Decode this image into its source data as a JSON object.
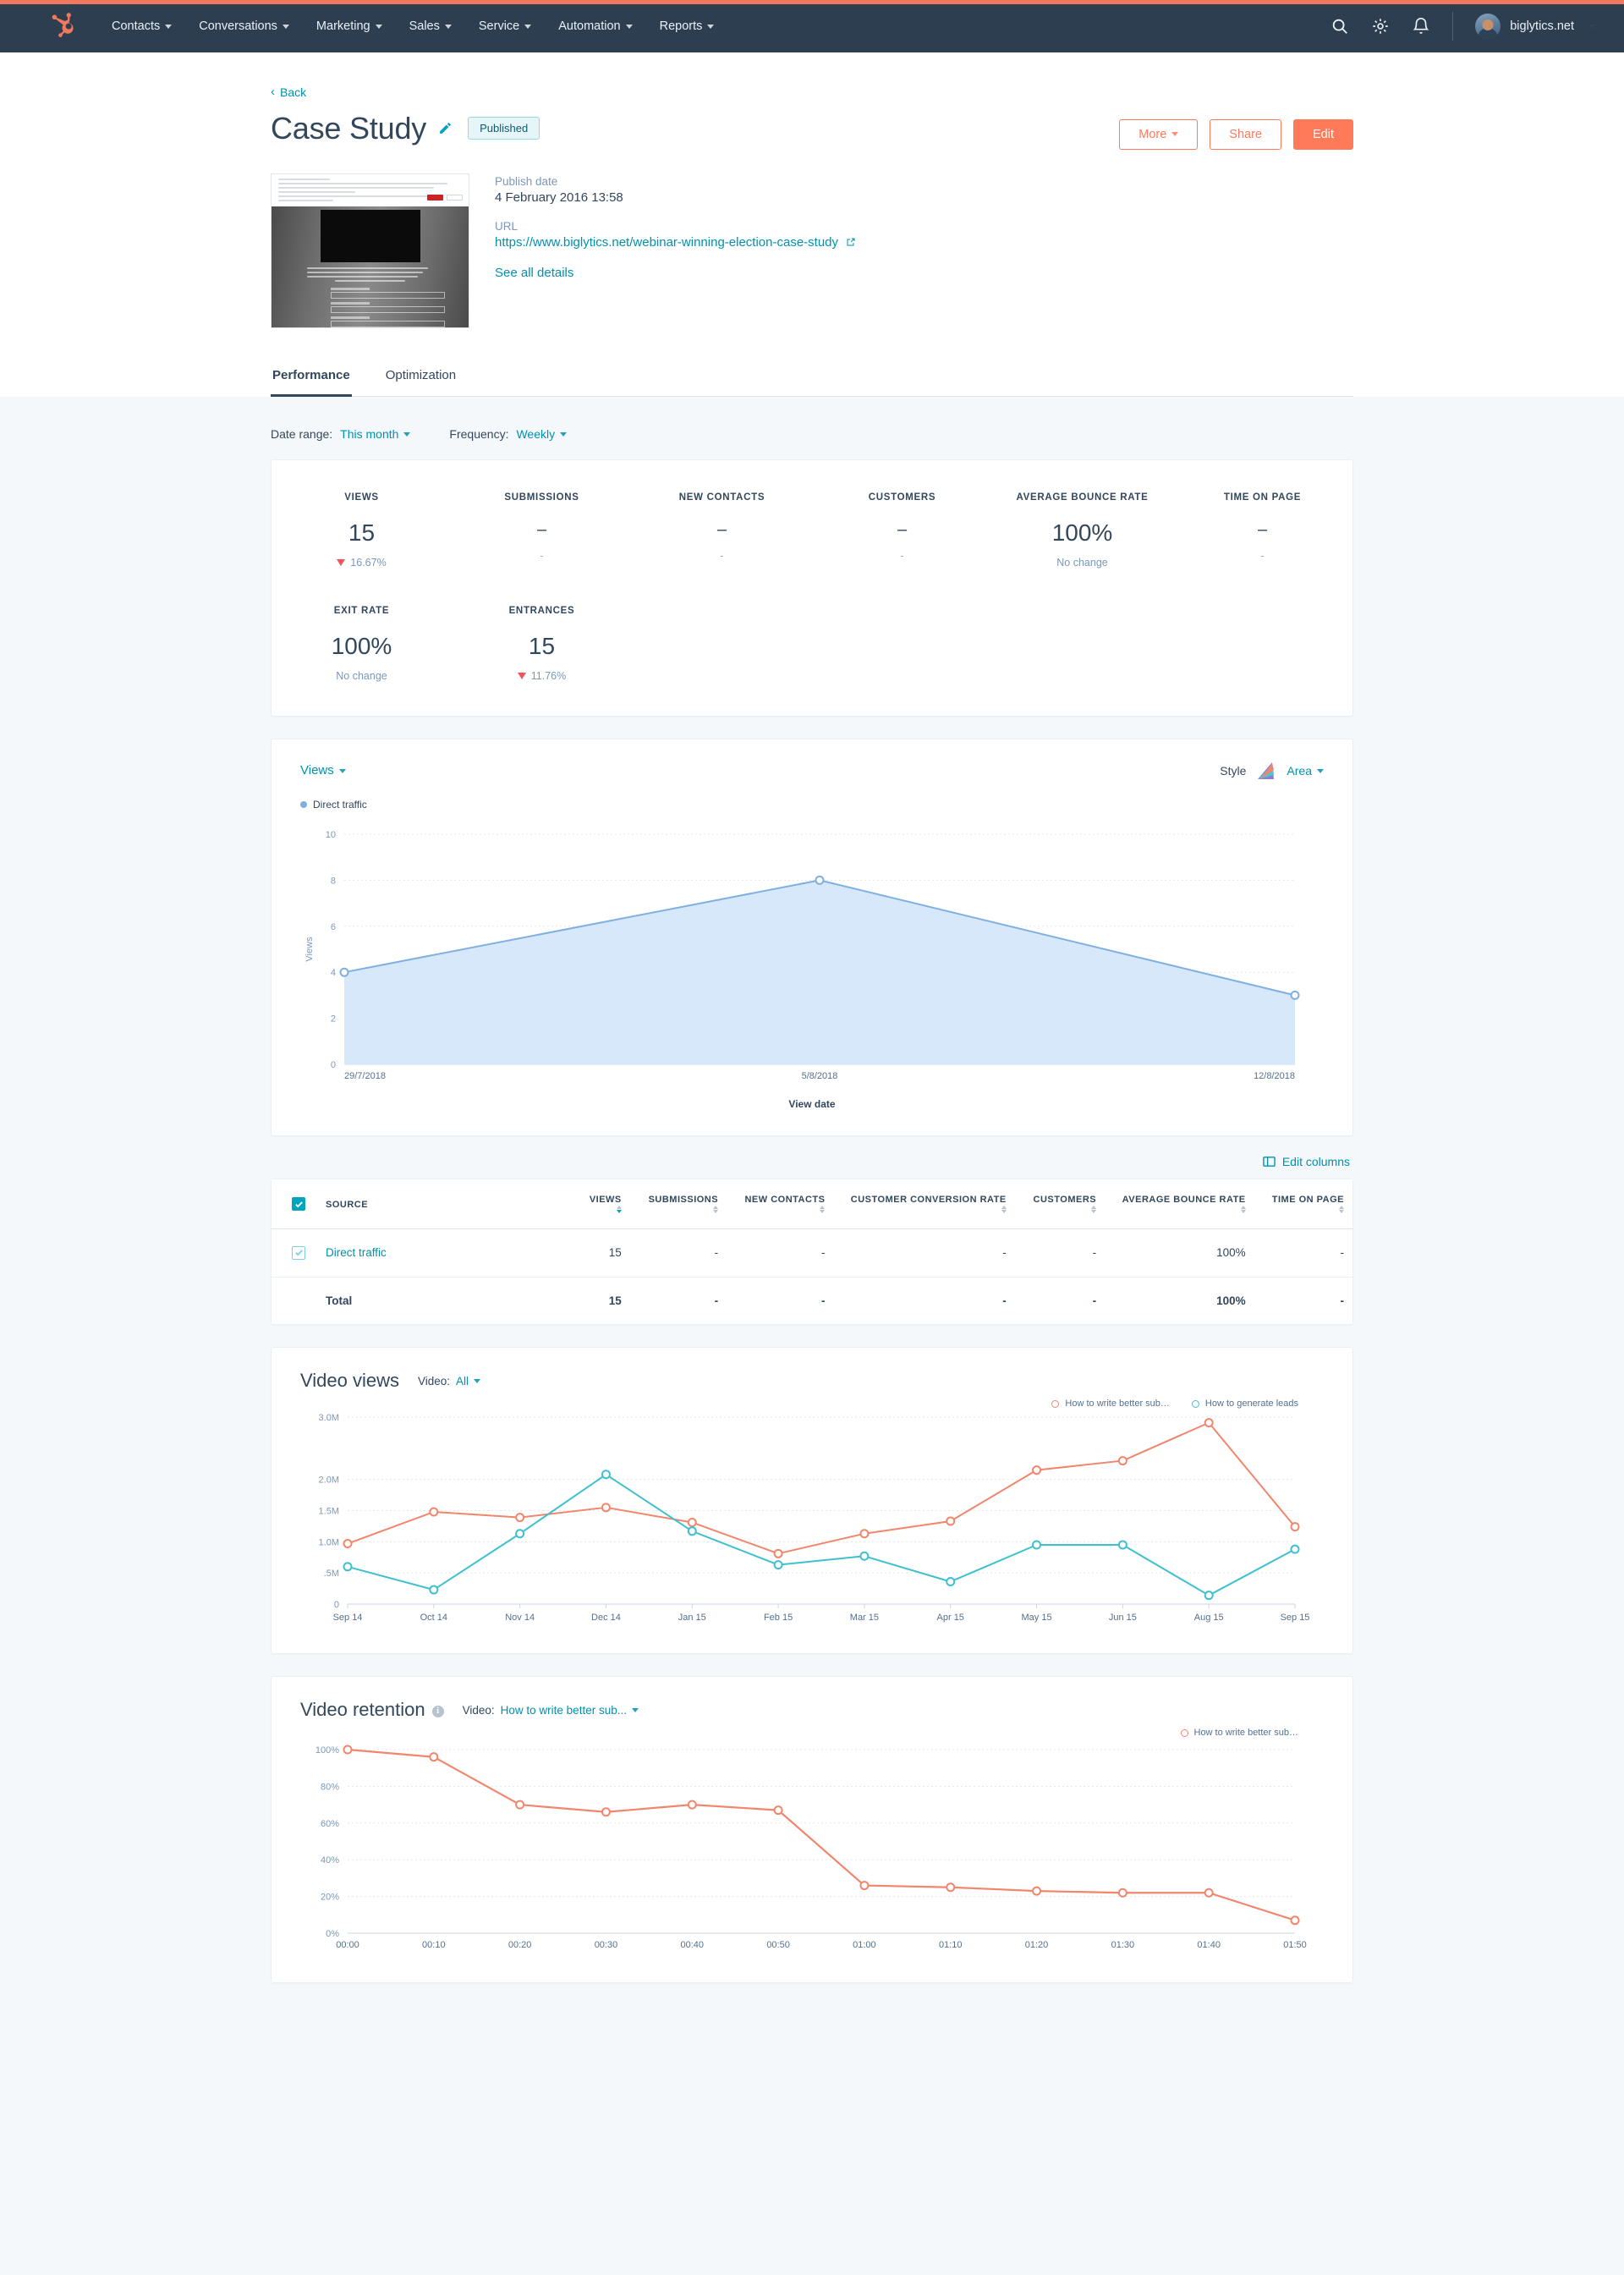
{
  "topnav": {
    "logo": "hubspot-sprocket-logo",
    "items": [
      {
        "label": "Contacts",
        "caret": true
      },
      {
        "label": "Conversations",
        "caret": true
      },
      {
        "label": "Marketing",
        "caret": true
      },
      {
        "label": "Sales",
        "caret": true
      },
      {
        "label": "Service",
        "caret": true
      },
      {
        "label": "Automation",
        "caret": true
      },
      {
        "label": "Reports",
        "caret": true
      }
    ],
    "account_name": "biglytics.net",
    "icons": [
      "search-icon",
      "gear-icon",
      "bell-icon"
    ]
  },
  "header": {
    "back_label": "Back",
    "title": "Case Study",
    "status_badge": "Published",
    "buttons": {
      "more": "More",
      "share": "Share",
      "edit": "Edit"
    }
  },
  "meta": {
    "publish_date_label": "Publish date",
    "publish_date_value": "4 February 2016 13:58",
    "url_label": "URL",
    "url_value": "https://www.biglytics.net/webinar-winning-election-case-study",
    "see_all_details": "See all details"
  },
  "tabs": [
    {
      "label": "Performance",
      "active": true
    },
    {
      "label": "Optimization",
      "active": false
    }
  ],
  "filters": {
    "date_range_label": "Date range:",
    "date_range_value": "This month",
    "frequency_label": "Frequency:",
    "frequency_value": "Weekly"
  },
  "kpis_row1": [
    {
      "label": "VIEWS",
      "value": "15",
      "delta": "16.67%",
      "trend": "down"
    },
    {
      "label": "SUBMISSIONS",
      "value": "–",
      "delta": "-",
      "trend": "none"
    },
    {
      "label": "NEW CONTACTS",
      "value": "–",
      "delta": "-",
      "trend": "none"
    },
    {
      "label": "CUSTOMERS",
      "value": "–",
      "delta": "-",
      "trend": "none"
    },
    {
      "label": "AVERAGE BOUNCE RATE",
      "value": "100%",
      "delta": "No change",
      "trend": "none"
    },
    {
      "label": "TIME ON PAGE",
      "value": "–",
      "delta": "-",
      "trend": "none"
    }
  ],
  "kpis_row2": [
    {
      "label": "EXIT RATE",
      "value": "100%",
      "delta": "No change",
      "trend": "none"
    },
    {
      "label": "ENTRANCES",
      "value": "15",
      "delta": "11.76%",
      "trend": "down"
    }
  ],
  "views_chart_panel": {
    "metric_dropdown": "Views",
    "style_label": "Style",
    "style_value": "Area",
    "legend": [
      "Direct traffic"
    ]
  },
  "table": {
    "edit_columns_label": "Edit columns",
    "headers": [
      "SOURCE",
      "VIEWS",
      "SUBMISSIONS",
      "NEW CONTACTS",
      "CUSTOMER CONVERSION RATE",
      "CUSTOMERS",
      "AVERAGE BOUNCE RATE",
      "TIME ON PAGE"
    ],
    "rows": [
      {
        "source": "Direct traffic",
        "views": "15",
        "submissions": "-",
        "new_contacts": "-",
        "conversion_rate": "-",
        "customers": "-",
        "bounce_rate": "100%",
        "time_on_page": "-",
        "checked": true
      }
    ],
    "total": {
      "source": "Total",
      "views": "15",
      "submissions": "-",
      "new_contacts": "-",
      "conversion_rate": "-",
      "customers": "-",
      "bounce_rate": "100%",
      "time_on_page": "-"
    }
  },
  "video_views_panel": {
    "title": "Video views",
    "filter_label": "Video:",
    "filter_value": "All"
  },
  "video_retention_panel": {
    "title": "Video retention",
    "filter_label": "Video:",
    "filter_value": "How to write better sub..."
  },
  "chart_data": [
    {
      "type": "area",
      "title": "Views",
      "xlabel": "View date",
      "ylabel": "Views",
      "x": [
        "29/7/2018",
        "5/8/2018",
        "12/8/2018"
      ],
      "series": [
        {
          "name": "Direct traffic",
          "values": [
            4,
            8,
            3
          ],
          "color": "#7fb0e0",
          "fill": "#d6e8f9"
        }
      ],
      "ylim": [
        0,
        10
      ],
      "yticks": [
        0,
        2,
        4,
        6,
        8,
        10
      ],
      "grid": true,
      "legend_position": "top-left"
    },
    {
      "type": "line",
      "title": "Video views",
      "xlabel": "",
      "ylabel": "",
      "x": [
        "Sep 14",
        "Oct 14",
        "Nov 14",
        "Dec 14",
        "Jan 15",
        "Feb 15",
        "Mar 15",
        "Apr 15",
        "May 15",
        "Jun 15",
        "Aug 15",
        "Sep 15"
      ],
      "series": [
        {
          "name": "How to write better sub…",
          "color": "#f2866d",
          "values": [
            0.97,
            1.48,
            1.39,
            1.55,
            1.31,
            0.81,
            1.13,
            1.33,
            2.15,
            2.3,
            2.91,
            1.24
          ]
        },
        {
          "name": "How to generate leads",
          "color": "#3fc0cf",
          "values": [
            0.6,
            0.23,
            1.13,
            2.08,
            1.17,
            0.63,
            0.77,
            0.36,
            0.95,
            0.95,
            0.14,
            0.88
          ]
        }
      ],
      "ylim": [
        0,
        3.0
      ],
      "yticks": [
        0,
        0.5,
        1.0,
        1.5,
        2.0,
        3.0
      ],
      "ytick_labels": [
        "0",
        ".5M",
        "1.0M",
        "1.5M",
        "2.0M",
        "3.0M"
      ],
      "unit": "M",
      "grid": true,
      "legend_position": "top-right"
    },
    {
      "type": "line",
      "title": "Video retention",
      "xlabel": "",
      "ylabel": "",
      "x": [
        "00:00",
        "00:10",
        "00:20",
        "00:30",
        "00:40",
        "00:50",
        "01:00",
        "01:10",
        "01:20",
        "01:30",
        "01:40",
        "01:50"
      ],
      "series": [
        {
          "name": "How to write better sub…",
          "color": "#f2866d",
          "values": [
            100,
            96,
            70,
            66,
            70,
            67,
            26,
            25,
            23,
            22,
            22,
            7
          ]
        }
      ],
      "ylim": [
        0,
        100
      ],
      "yticks": [
        0,
        20,
        40,
        60,
        80,
        100
      ],
      "ytick_labels": [
        "0%",
        "20%",
        "40%",
        "60%",
        "80%",
        "100%"
      ],
      "grid": true,
      "legend_position": "top-right"
    }
  ]
}
